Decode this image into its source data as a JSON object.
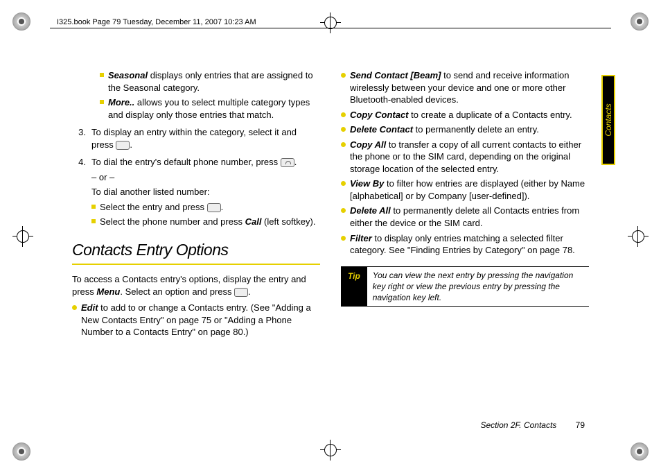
{
  "header_text": "I325.book  Page 79  Tuesday, December 11, 2007  10:23 AM",
  "side_tab": "Contacts",
  "left": {
    "seasonal_label": "Seasonal",
    "seasonal_text": " displays only entries that are assigned to the Seasonal category.",
    "more_label": "More..",
    "more_text": " allows you to select multiple category types and display only those entries that match.",
    "step3_num": "3.",
    "step3": "To display an entry within the category, select it and press ",
    "step4_num": "4.",
    "step4": "To dial the entry's default phone number, press ",
    "or": "– or –",
    "dial_other": "To dial another listed number:",
    "sub_a": "Select the entry and press ",
    "sub_b_pre": "Select the phone number and press ",
    "sub_b_bold": "Call",
    "sub_b_post": " (left softkey).",
    "section_title": "Contacts Entry Options",
    "intro_a": "To access a Contacts entry's options, display the entry and press ",
    "intro_menu": "Menu",
    "intro_b": ". Select an option and press ",
    "edit_label": "Edit",
    "edit_text": " to add to or change a Contacts entry. (See \"Adding a New Contacts Entry\" on page 75 or \"Adding a Phone Number to a Contacts Entry\" on page 80.)"
  },
  "right": {
    "send_label": "Send Contact [Beam]",
    "send_text": " to send and receive information wirelessly between your device and one or more other Bluetooth-enabled devices.",
    "copy_label": "Copy Contact",
    "copy_text": " to create a duplicate of a Contacts entry.",
    "del_label": "Delete Contact",
    "del_text": " to permanently delete an entry.",
    "copyall_label": "Copy All",
    "copyall_text": " to transfer a copy of all current contacts to either the phone or to the SIM card, depending on the original storage location of the selected entry.",
    "view_label": "View By",
    "view_text": " to filter how entries are displayed (either by Name [alphabetical] or by Company [user-defined]).",
    "delall_label": "Delete All",
    "delall_text": " to permanently delete all Contacts entries from either the device or the SIM card.",
    "filter_label": "Filter",
    "filter_text": " to display only entries matching a selected filter category. See \"Finding Entries by Category\" on page 78.",
    "tip_label": "Tip",
    "tip_text": "You can view the next entry by pressing the navigation key right or view the previous entry by pressing the navigation key left."
  },
  "footer_section": "Section 2F. Contacts",
  "footer_page": "79"
}
